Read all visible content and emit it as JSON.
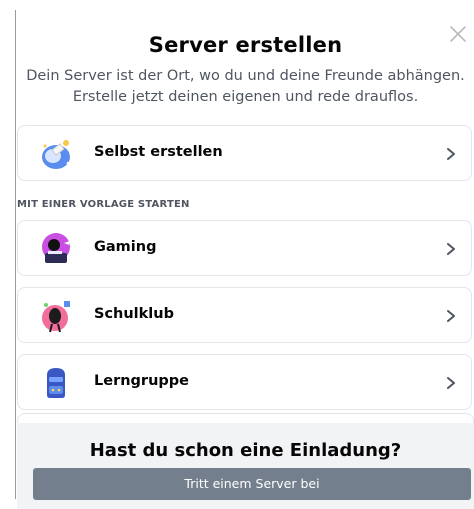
{
  "modal": {
    "title": "Server erstellen",
    "subtitle_line1": "Dein Server ist der Ort, wo du und deine Freunde abhängen.",
    "subtitle_line2": "Erstelle jetzt deinen eigenen und rede drauflos."
  },
  "create_own": {
    "label": "Selbst erstellen",
    "icon": "create-own-icon"
  },
  "templates": {
    "section_label": "MIT EINER VORLAGE STARTEN",
    "items": [
      {
        "label": "Gaming",
        "icon": "gaming-icon"
      },
      {
        "label": "Schulklub",
        "icon": "school-club-icon"
      },
      {
        "label": "Lerngruppe",
        "icon": "study-group-icon"
      }
    ]
  },
  "footer": {
    "title": "Hast du schon eine Einladung?",
    "join_button": "Tritt einem Server bei"
  },
  "colors": {
    "join_button": "#747f8d",
    "footer_bg": "#f2f3f5",
    "card_border": "#e3e5e8"
  }
}
